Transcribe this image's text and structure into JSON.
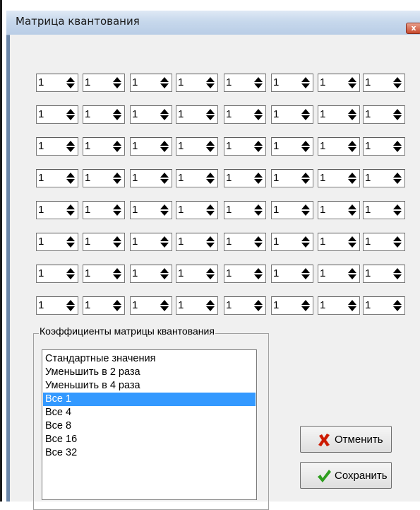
{
  "window": {
    "title": "Матрица квантования",
    "close_glyph": "x"
  },
  "matrix": {
    "rows": 8,
    "cols": 8,
    "values": [
      [
        "1",
        "1",
        "1",
        "1",
        "1",
        "1",
        "1",
        "1"
      ],
      [
        "1",
        "1",
        "1",
        "1",
        "1",
        "1",
        "1",
        "1"
      ],
      [
        "1",
        "1",
        "1",
        "1",
        "1",
        "1",
        "1",
        "1"
      ],
      [
        "1",
        "1",
        "1",
        "1",
        "1",
        "1",
        "1",
        "1"
      ],
      [
        "1",
        "1",
        "1",
        "1",
        "1",
        "1",
        "1",
        "1"
      ],
      [
        "1",
        "1",
        "1",
        "1",
        "1",
        "1",
        "1",
        "1"
      ],
      [
        "1",
        "1",
        "1",
        "1",
        "1",
        "1",
        "1",
        "1"
      ],
      [
        "1",
        "1",
        "1",
        "1",
        "1",
        "1",
        "1",
        "1"
      ]
    ]
  },
  "coefficients": {
    "group_label": "Коэффициенты матрицы квантования",
    "items": [
      "Стандартные значения",
      "Уменьшить в 2 раза",
      "Уменьшить в 4 раза",
      "Все 1",
      "Все 4",
      "Все 8",
      "Все 16",
      "Все 32"
    ],
    "selected_index": 3
  },
  "buttons": {
    "cancel_label": "Отменить",
    "cancel_icon": "red-x-icon",
    "save_label": "Сохранить",
    "save_icon": "green-check-icon"
  },
  "colors": {
    "selection": "#3399ff",
    "cancel_icon": "#cc1a00",
    "save_icon": "#2e9e1e"
  }
}
